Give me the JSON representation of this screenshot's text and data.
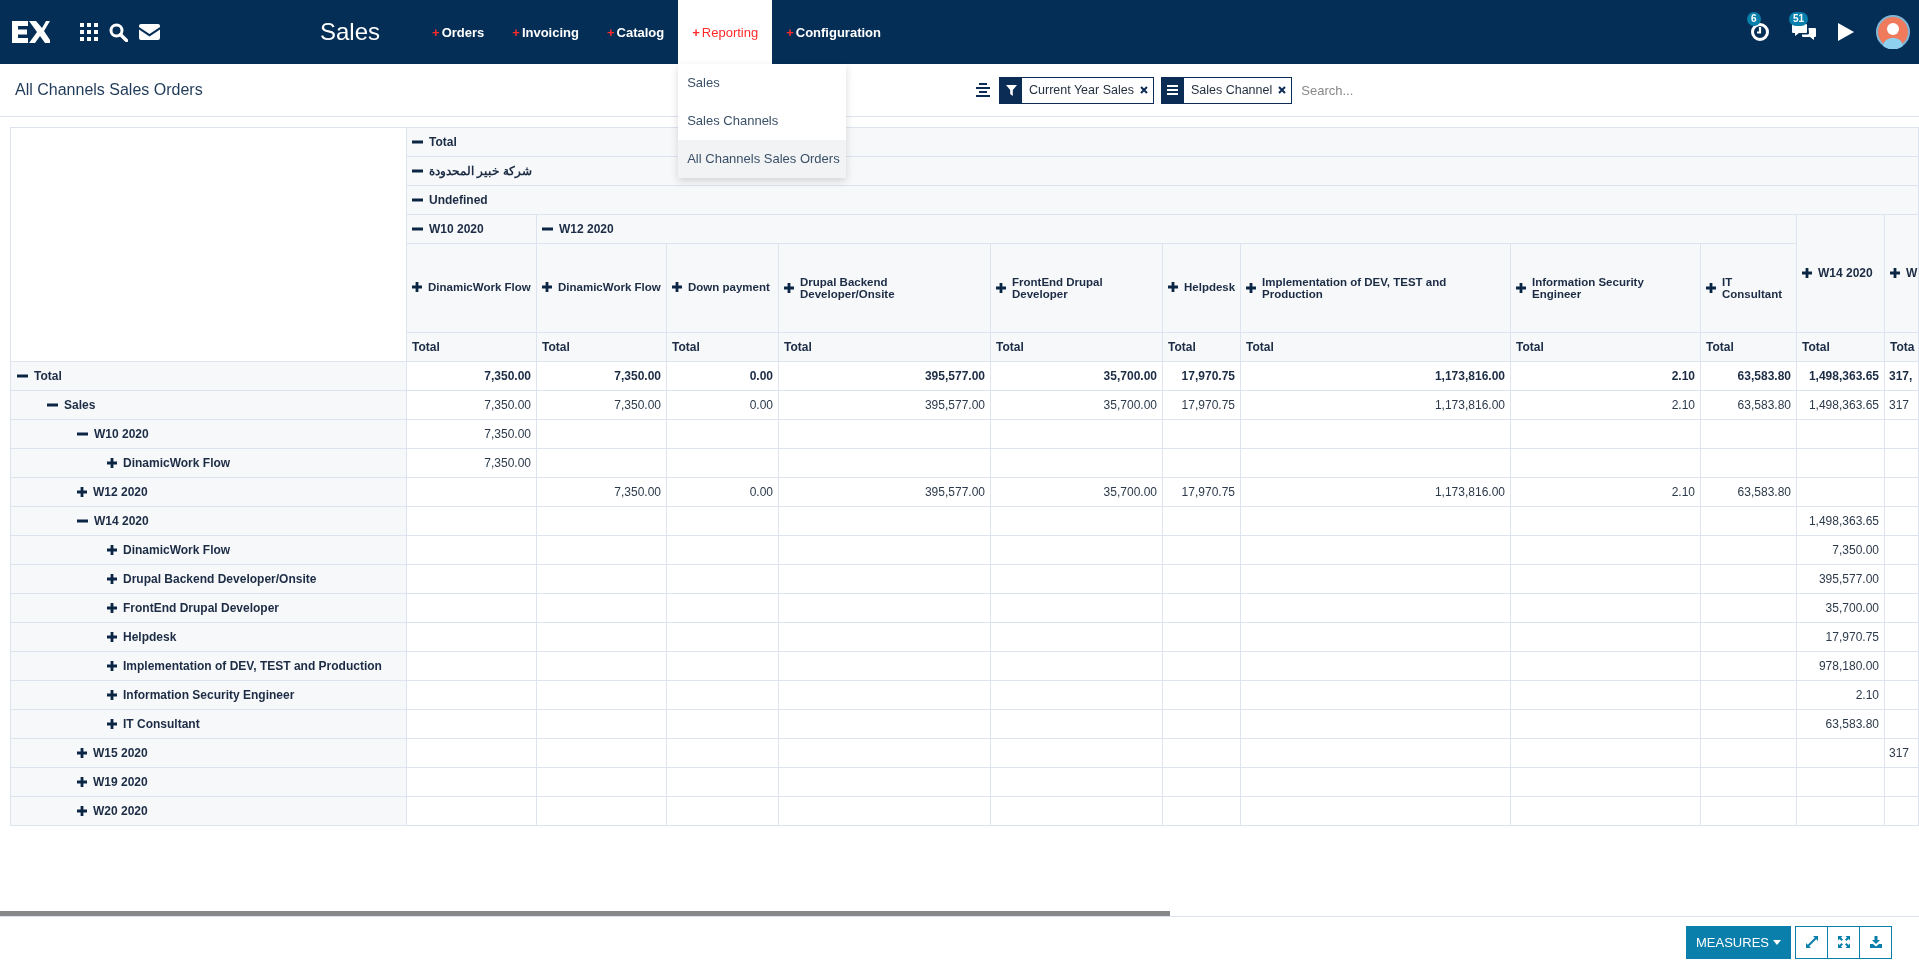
{
  "app_title": "Sales",
  "menu": [
    {
      "marker": "+",
      "label": "Orders",
      "selected": false
    },
    {
      "marker": "+",
      "label": "Invoicing",
      "selected": false
    },
    {
      "marker": "+",
      "label": "Catalog",
      "selected": false
    },
    {
      "marker": "+",
      "label": "Reporting",
      "selected": true,
      "dropdown": [
        {
          "label": "Sales",
          "selected": false
        },
        {
          "label": "Sales Channels",
          "selected": false
        },
        {
          "label": "All Channels Sales Orders",
          "selected": true
        }
      ]
    },
    {
      "marker": "+",
      "label": "Configuration",
      "selected": false
    }
  ],
  "notifications": {
    "activity_count": "6",
    "message_count": "51"
  },
  "page_title": "All Channels Sales Orders",
  "facets": [
    {
      "kind": "filter",
      "label": "Current Year Sales"
    },
    {
      "kind": "group",
      "label": "Sales Channel"
    }
  ],
  "search": {
    "placeholder": "Search..."
  },
  "column_headers": [
    {
      "label": "Total",
      "expanded": true
    },
    {
      "label": "شركة خبير المحدودة",
      "expanded": true
    },
    {
      "label": "Undefined",
      "expanded": true
    }
  ],
  "column_groups": [
    {
      "label": "W10 2020",
      "expanded": true,
      "children": [
        {
          "label": "DinamicWork Flow",
          "expanded": false
        }
      ]
    },
    {
      "label": "W12 2020",
      "expanded": true,
      "children": [
        {
          "label": "DinamicWork Flow",
          "expanded": false
        },
        {
          "label": "Down payment",
          "expanded": false
        },
        {
          "label": "Drupal Backend Developer/Onsite",
          "expanded": false
        },
        {
          "label": "FrontEnd Drupal Developer",
          "expanded": false
        },
        {
          "label": "Helpdesk",
          "expanded": false
        },
        {
          "label": "Implementation of DEV, TEST and Production",
          "expanded": false
        },
        {
          "label": "Information Security Engineer",
          "expanded": false
        },
        {
          "label": "IT Consultant",
          "expanded": false
        }
      ]
    },
    {
      "label": "W14 2020",
      "expanded": false
    },
    {
      "label": "W",
      "expanded": false
    }
  ],
  "measure_headers": [
    "Total",
    "Total",
    "Total",
    "Total",
    "Total",
    "Total",
    "Total",
    "Total",
    "Total",
    "Total",
    "Tota"
  ],
  "rows": [
    {
      "label": "Total",
      "expanded": true,
      "values": [
        {
          "text": "7,350.00"
        },
        {
          "text": "7,350.00"
        },
        {
          "text": "0.00"
        },
        {
          "text": "395,577.00"
        },
        {
          "text": "35,700.00"
        },
        {
          "text": "17,970.75"
        },
        {
          "text": "1,173,816.00"
        },
        {
          "text": "2.10"
        },
        {
          "text": "63,583.80"
        },
        {
          "text": "1,498,363.65"
        },
        {
          "text": "317,"
        }
      ],
      "children": [
        {
          "label": "Sales",
          "expanded": true,
          "values": [
            {
              "text": "7,350.00"
            },
            {
              "text": "7,350.00"
            },
            {
              "text": "0.00"
            },
            {
              "text": "395,577.00"
            },
            {
              "text": "35,700.00"
            },
            {
              "text": "17,970.75"
            },
            {
              "text": "1,173,816.00"
            },
            {
              "text": "2.10"
            },
            {
              "text": "63,583.80"
            },
            {
              "text": "1,498,363.65"
            },
            {
              "text": "317"
            }
          ],
          "children": [
            {
              "label": "W10 2020",
              "expanded": true,
              "values": [
                {
                  "text": "7,350.00"
                },
                {
                  "blank": true
                },
                {
                  "blank": true
                },
                {
                  "blank": true
                },
                {
                  "blank": true
                },
                {
                  "blank": true
                },
                {
                  "blank": true
                },
                {
                  "blank": true
                },
                {
                  "blank": true
                },
                {
                  "blank": true
                },
                {
                  "blank": true
                }
              ],
              "children": [
                {
                  "label": "DinamicWork Flow",
                  "expanded": false,
                  "values": [
                    {
                      "text": "7,350.00"
                    },
                    {
                      "blank": true
                    },
                    {
                      "blank": true
                    },
                    {
                      "blank": true
                    },
                    {
                      "blank": true
                    },
                    {
                      "blank": true
                    },
                    {
                      "blank": true
                    },
                    {
                      "blank": true
                    },
                    {
                      "blank": true
                    },
                    {
                      "blank": true
                    },
                    {
                      "blank": true
                    }
                  ]
                }
              ]
            },
            {
              "label": "W12 2020",
              "expanded": false,
              "values": [
                {
                  "blank": true
                },
                {
                  "text": "7,350.00"
                },
                {
                  "text": "0.00"
                },
                {
                  "text": "395,577.00"
                },
                {
                  "text": "35,700.00"
                },
                {
                  "text": "17,970.75"
                },
                {
                  "text": "1,173,816.00"
                },
                {
                  "text": "2.10"
                },
                {
                  "text": "63,583.80"
                },
                {
                  "blank": true
                },
                {
                  "blank": true
                }
              ]
            },
            {
              "label": "W14 2020",
              "expanded": true,
              "values": [
                {
                  "blank": true
                },
                {
                  "blank": true
                },
                {
                  "blank": true
                },
                {
                  "blank": true
                },
                {
                  "blank": true
                },
                {
                  "blank": true
                },
                {
                  "blank": true
                },
                {
                  "blank": true
                },
                {
                  "blank": true
                },
                {
                  "text": "1,498,363.65"
                },
                {
                  "blank": true
                }
              ],
              "children": [
                {
                  "label": "DinamicWork Flow",
                  "expanded": false,
                  "values": [
                    {
                      "blank": true
                    },
                    {
                      "blank": true
                    },
                    {
                      "blank": true
                    },
                    {
                      "blank": true
                    },
                    {
                      "blank": true
                    },
                    {
                      "blank": true
                    },
                    {
                      "blank": true
                    },
                    {
                      "blank": true
                    },
                    {
                      "blank": true
                    },
                    {
                      "text": "7,350.00"
                    },
                    {
                      "blank": true
                    }
                  ]
                },
                {
                  "label": "Drupal Backend Developer/Onsite",
                  "expanded": false,
                  "values": [
                    {
                      "blank": true
                    },
                    {
                      "blank": true
                    },
                    {
                      "blank": true
                    },
                    {
                      "blank": true
                    },
                    {
                      "blank": true
                    },
                    {
                      "blank": true
                    },
                    {
                      "blank": true
                    },
                    {
                      "blank": true
                    },
                    {
                      "blank": true
                    },
                    {
                      "text": "395,577.00"
                    },
                    {
                      "blank": true
                    }
                  ]
                },
                {
                  "label": "FrontEnd Drupal Developer",
                  "expanded": false,
                  "values": [
                    {
                      "blank": true
                    },
                    {
                      "blank": true
                    },
                    {
                      "blank": true
                    },
                    {
                      "blank": true
                    },
                    {
                      "blank": true
                    },
                    {
                      "blank": true
                    },
                    {
                      "blank": true
                    },
                    {
                      "blank": true
                    },
                    {
                      "blank": true
                    },
                    {
                      "text": "35,700.00"
                    },
                    {
                      "blank": true
                    }
                  ]
                },
                {
                  "label": "Helpdesk",
                  "expanded": false,
                  "values": [
                    {
                      "blank": true
                    },
                    {
                      "blank": true
                    },
                    {
                      "blank": true
                    },
                    {
                      "blank": true
                    },
                    {
                      "blank": true
                    },
                    {
                      "blank": true
                    },
                    {
                      "blank": true
                    },
                    {
                      "blank": true
                    },
                    {
                      "blank": true
                    },
                    {
                      "text": "17,970.75"
                    },
                    {
                      "blank": true
                    }
                  ]
                },
                {
                  "label": "Implementation of DEV, TEST and Production",
                  "expanded": false,
                  "values": [
                    {
                      "blank": true
                    },
                    {
                      "blank": true
                    },
                    {
                      "blank": true
                    },
                    {
                      "blank": true
                    },
                    {
                      "blank": true
                    },
                    {
                      "blank": true
                    },
                    {
                      "blank": true
                    },
                    {
                      "blank": true
                    },
                    {
                      "blank": true
                    },
                    {
                      "text": "978,180.00"
                    },
                    {
                      "blank": true
                    }
                  ]
                },
                {
                  "label": "Information Security Engineer",
                  "expanded": false,
                  "values": [
                    {
                      "blank": true
                    },
                    {
                      "blank": true
                    },
                    {
                      "blank": true
                    },
                    {
                      "blank": true
                    },
                    {
                      "blank": true
                    },
                    {
                      "blank": true
                    },
                    {
                      "blank": true
                    },
                    {
                      "blank": true
                    },
                    {
                      "blank": true
                    },
                    {
                      "text": "2.10"
                    },
                    {
                      "blank": true
                    }
                  ]
                },
                {
                  "label": "IT Consultant",
                  "expanded": false,
                  "values": [
                    {
                      "blank": true
                    },
                    {
                      "blank": true
                    },
                    {
                      "blank": true
                    },
                    {
                      "blank": true
                    },
                    {
                      "blank": true
                    },
                    {
                      "blank": true
                    },
                    {
                      "blank": true
                    },
                    {
                      "blank": true
                    },
                    {
                      "blank": true
                    },
                    {
                      "text": "63,583.80"
                    },
                    {
                      "blank": true
                    }
                  ]
                }
              ]
            },
            {
              "label": "W15 2020",
              "expanded": false,
              "values": [
                {
                  "blank": true
                },
                {
                  "blank": true
                },
                {
                  "blank": true
                },
                {
                  "blank": true
                },
                {
                  "blank": true
                },
                {
                  "blank": true
                },
                {
                  "blank": true
                },
                {
                  "blank": true
                },
                {
                  "blank": true
                },
                {
                  "blank": true
                },
                {
                  "text": "317"
                }
              ]
            },
            {
              "label": "W19 2020",
              "expanded": false,
              "values": [
                {
                  "blank": true
                },
                {
                  "blank": true
                },
                {
                  "blank": true
                },
                {
                  "blank": true
                },
                {
                  "blank": true
                },
                {
                  "blank": true
                },
                {
                  "blank": true
                },
                {
                  "blank": true
                },
                {
                  "blank": true
                },
                {
                  "blank": true
                },
                {
                  "blank": true
                }
              ]
            },
            {
              "label": "W20 2020",
              "expanded": false,
              "values": [
                {
                  "blank": true
                },
                {
                  "blank": true
                },
                {
                  "blank": true
                },
                {
                  "blank": true
                },
                {
                  "blank": true
                },
                {
                  "blank": true
                },
                {
                  "blank": true
                },
                {
                  "blank": true
                },
                {
                  "blank": true
                },
                {
                  "blank": true
                },
                {
                  "blank": true
                }
              ]
            }
          ]
        }
      ]
    }
  ],
  "footer": {
    "measures_label": "MEASURES"
  }
}
